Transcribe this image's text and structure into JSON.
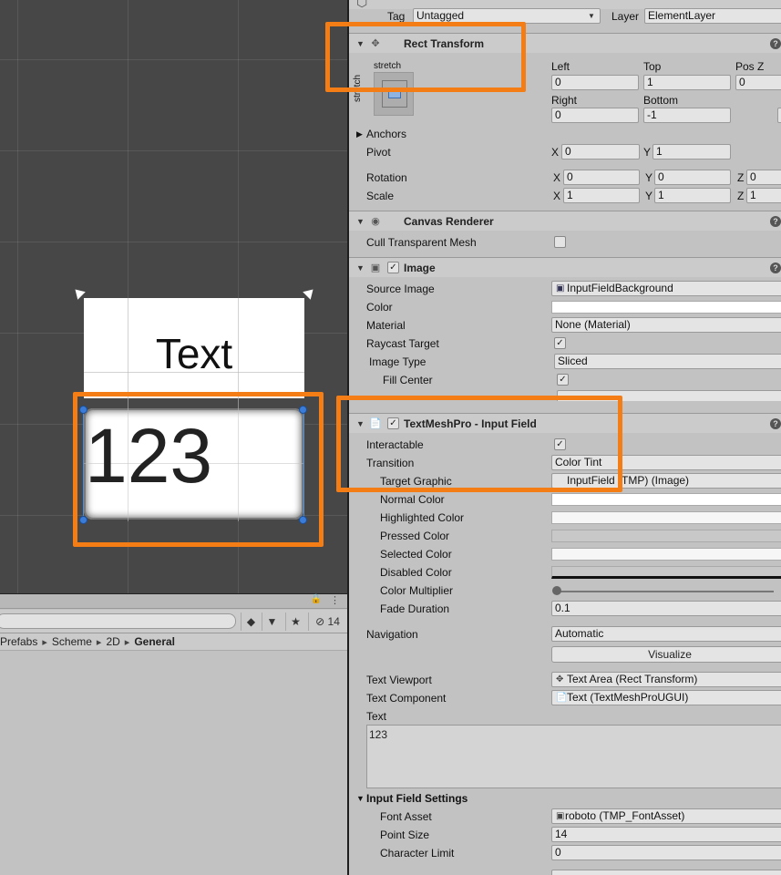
{
  "scene": {
    "label_text": "Text",
    "input_value": "123"
  },
  "project": {
    "hidden_count": "14",
    "breadcrumb": [
      "Prefabs",
      "Scheme",
      "2D",
      "General"
    ]
  },
  "inspector": {
    "top": {
      "tag_label": "Tag",
      "tag_value": "Untagged",
      "layer_label": "Layer",
      "layer_value": "ElementLayer"
    },
    "rect_transform": {
      "title": "Rect Transform",
      "stretch_h": "stretch",
      "stretch_v": "stretch",
      "left_label": "Left",
      "left": "0",
      "top_label": "Top",
      "top": "1",
      "posz_label": "Pos Z",
      "posz": "0",
      "right_label": "Right",
      "right": "0",
      "bottom_label": "Bottom",
      "bottom": "-1",
      "anchors_label": "Anchors",
      "pivot_label": "Pivot",
      "pivot_x": "0",
      "pivot_y": "1",
      "rotation_label": "Rotation",
      "rot_x": "0",
      "rot_y": "0",
      "rot_z": "0",
      "scale_label": "Scale",
      "scale_x": "1",
      "scale_y": "1",
      "scale_z": "1",
      "x": "X",
      "y": "Y",
      "z": "Z"
    },
    "canvas_renderer": {
      "title": "Canvas Renderer",
      "cull_label": "Cull Transparent Mesh"
    },
    "image": {
      "title": "Image",
      "source_label": "Source Image",
      "source": "InputFieldBackground",
      "color_label": "Color",
      "material_label": "Material",
      "material": "None (Material)",
      "raycast_label": "Raycast Target",
      "image_type_label": "Image Type",
      "image_type": "Sliced",
      "fill_center_label": "Fill Center"
    },
    "input_field": {
      "title": "TextMeshPro - Input Field",
      "interactable_label": "Interactable",
      "transition_label": "Transition",
      "transition": "Color Tint",
      "target_graphic_label": "Target Graphic",
      "target_graphic": "InputField (TMP) (Image)",
      "normal_label": "Normal Color",
      "highlighted_label": "Highlighted Color",
      "pressed_label": "Pressed Color",
      "selected_label": "Selected Color",
      "disabled_label": "Disabled Color",
      "multiplier_label": "Color Multiplier",
      "fade_label": "Fade Duration",
      "fade": "0.1",
      "navigation_label": "Navigation",
      "navigation": "Automatic",
      "visualize": "Visualize",
      "viewport_label": "Text Viewport",
      "viewport": "Text Area (Rect Transform)",
      "component_label": "Text Component",
      "component": "Text (TextMeshProUGUI)",
      "text_label": "Text",
      "text": "123"
    },
    "settings": {
      "title": "Input Field Settings",
      "font_asset_label": "Font Asset",
      "font_asset": "roboto (TMP_FontAsset)",
      "point_size_label": "Point Size",
      "point_size": "14",
      "char_limit_label": "Character Limit",
      "char_limit": "0"
    }
  }
}
